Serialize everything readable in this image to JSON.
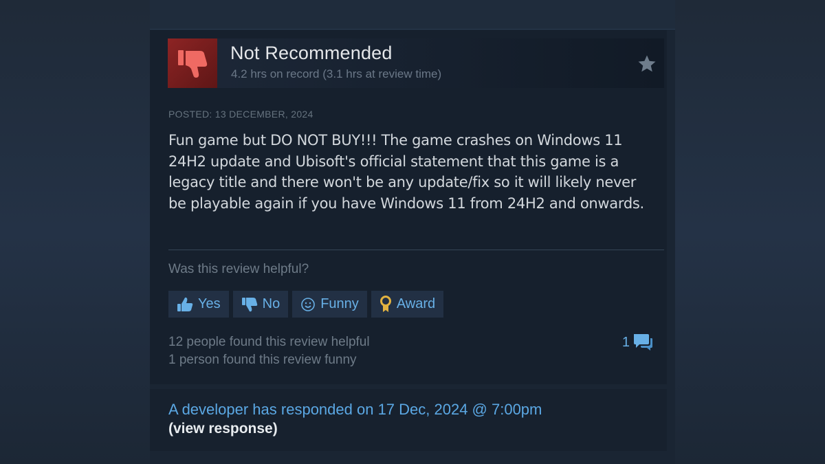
{
  "review": {
    "verdict": "Not Recommended",
    "hours": "4.2 hrs on record (3.1 hrs at review time)",
    "posted": "POSTED: 13 DECEMBER, 2024",
    "body": "Fun game but DO NOT BUY!!! The game crashes on Windows 11 24H2 update and Ubisoft's official statement that this game is a legacy title and there won't be any update/fix so it will likely never be playable again if you have Windows 11 from 24H2 and onwards."
  },
  "helpful": {
    "question": "Was this review helpful?",
    "buttons": {
      "yes": "Yes",
      "no": "No",
      "funny": "Funny",
      "award": "Award"
    },
    "helpful_count_text": "12 people found this review helpful",
    "funny_count_text": "1 person found this review funny",
    "comment_count": "1"
  },
  "developer": {
    "response_line": "A developer has responded on 17 Dec, 2024 @ 7:00pm",
    "view_link": "(view response)"
  },
  "icons": {
    "verdict": "thumbs-down-icon",
    "star": "star-icon",
    "yes": "thumbs-up-icon",
    "no": "thumbs-down-icon",
    "funny": "smiley-icon",
    "award": "award-medal-icon",
    "comments": "speech-bubbles-icon"
  },
  "colors": {
    "thumb_bg": "#8d2424",
    "link_blue": "#68b0e6",
    "award_gold": "#e3b340"
  }
}
